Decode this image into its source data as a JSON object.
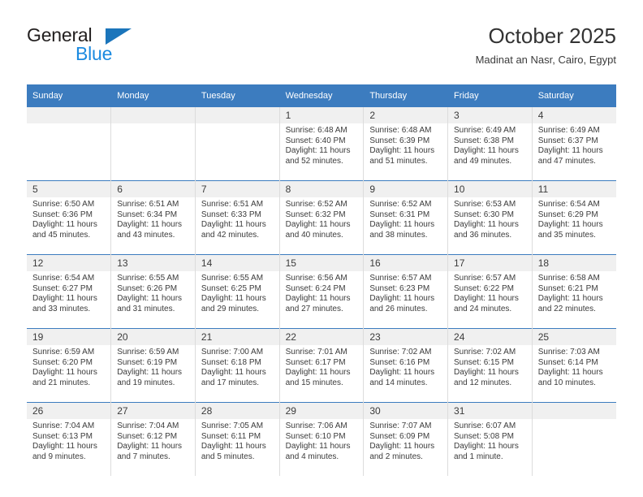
{
  "brand": {
    "general": "General",
    "blue": "Blue",
    "accent_color": "#1b75bb",
    "blue_text_color": "#1b8ae0"
  },
  "header": {
    "title": "October 2025",
    "subtitle": "Madinat an Nasr, Cairo, Egypt"
  },
  "theme": {
    "header_blue": "#3c7cbf",
    "daynum_band": "#f0f0f0",
    "text": "#3b3b3b",
    "divider": "#dcdcdc"
  },
  "calendar": {
    "day_headers": [
      "Sunday",
      "Monday",
      "Tuesday",
      "Wednesday",
      "Thursday",
      "Friday",
      "Saturday"
    ],
    "weeks": [
      [
        {
          "day": "",
          "sunrise": "",
          "sunset": "",
          "daylight1": "",
          "daylight2": ""
        },
        {
          "day": "",
          "sunrise": "",
          "sunset": "",
          "daylight1": "",
          "daylight2": ""
        },
        {
          "day": "",
          "sunrise": "",
          "sunset": "",
          "daylight1": "",
          "daylight2": ""
        },
        {
          "day": "1",
          "sunrise": "Sunrise: 6:48 AM",
          "sunset": "Sunset: 6:40 PM",
          "daylight1": "Daylight: 11 hours",
          "daylight2": "and 52 minutes."
        },
        {
          "day": "2",
          "sunrise": "Sunrise: 6:48 AM",
          "sunset": "Sunset: 6:39 PM",
          "daylight1": "Daylight: 11 hours",
          "daylight2": "and 51 minutes."
        },
        {
          "day": "3",
          "sunrise": "Sunrise: 6:49 AM",
          "sunset": "Sunset: 6:38 PM",
          "daylight1": "Daylight: 11 hours",
          "daylight2": "and 49 minutes."
        },
        {
          "day": "4",
          "sunrise": "Sunrise: 6:49 AM",
          "sunset": "Sunset: 6:37 PM",
          "daylight1": "Daylight: 11 hours",
          "daylight2": "and 47 minutes."
        }
      ],
      [
        {
          "day": "5",
          "sunrise": "Sunrise: 6:50 AM",
          "sunset": "Sunset: 6:36 PM",
          "daylight1": "Daylight: 11 hours",
          "daylight2": "and 45 minutes."
        },
        {
          "day": "6",
          "sunrise": "Sunrise: 6:51 AM",
          "sunset": "Sunset: 6:34 PM",
          "daylight1": "Daylight: 11 hours",
          "daylight2": "and 43 minutes."
        },
        {
          "day": "7",
          "sunrise": "Sunrise: 6:51 AM",
          "sunset": "Sunset: 6:33 PM",
          "daylight1": "Daylight: 11 hours",
          "daylight2": "and 42 minutes."
        },
        {
          "day": "8",
          "sunrise": "Sunrise: 6:52 AM",
          "sunset": "Sunset: 6:32 PM",
          "daylight1": "Daylight: 11 hours",
          "daylight2": "and 40 minutes."
        },
        {
          "day": "9",
          "sunrise": "Sunrise: 6:52 AM",
          "sunset": "Sunset: 6:31 PM",
          "daylight1": "Daylight: 11 hours",
          "daylight2": "and 38 minutes."
        },
        {
          "day": "10",
          "sunrise": "Sunrise: 6:53 AM",
          "sunset": "Sunset: 6:30 PM",
          "daylight1": "Daylight: 11 hours",
          "daylight2": "and 36 minutes."
        },
        {
          "day": "11",
          "sunrise": "Sunrise: 6:54 AM",
          "sunset": "Sunset: 6:29 PM",
          "daylight1": "Daylight: 11 hours",
          "daylight2": "and 35 minutes."
        }
      ],
      [
        {
          "day": "12",
          "sunrise": "Sunrise: 6:54 AM",
          "sunset": "Sunset: 6:27 PM",
          "daylight1": "Daylight: 11 hours",
          "daylight2": "and 33 minutes."
        },
        {
          "day": "13",
          "sunrise": "Sunrise: 6:55 AM",
          "sunset": "Sunset: 6:26 PM",
          "daylight1": "Daylight: 11 hours",
          "daylight2": "and 31 minutes."
        },
        {
          "day": "14",
          "sunrise": "Sunrise: 6:55 AM",
          "sunset": "Sunset: 6:25 PM",
          "daylight1": "Daylight: 11 hours",
          "daylight2": "and 29 minutes."
        },
        {
          "day": "15",
          "sunrise": "Sunrise: 6:56 AM",
          "sunset": "Sunset: 6:24 PM",
          "daylight1": "Daylight: 11 hours",
          "daylight2": "and 27 minutes."
        },
        {
          "day": "16",
          "sunrise": "Sunrise: 6:57 AM",
          "sunset": "Sunset: 6:23 PM",
          "daylight1": "Daylight: 11 hours",
          "daylight2": "and 26 minutes."
        },
        {
          "day": "17",
          "sunrise": "Sunrise: 6:57 AM",
          "sunset": "Sunset: 6:22 PM",
          "daylight1": "Daylight: 11 hours",
          "daylight2": "and 24 minutes."
        },
        {
          "day": "18",
          "sunrise": "Sunrise: 6:58 AM",
          "sunset": "Sunset: 6:21 PM",
          "daylight1": "Daylight: 11 hours",
          "daylight2": "and 22 minutes."
        }
      ],
      [
        {
          "day": "19",
          "sunrise": "Sunrise: 6:59 AM",
          "sunset": "Sunset: 6:20 PM",
          "daylight1": "Daylight: 11 hours",
          "daylight2": "and 21 minutes."
        },
        {
          "day": "20",
          "sunrise": "Sunrise: 6:59 AM",
          "sunset": "Sunset: 6:19 PM",
          "daylight1": "Daylight: 11 hours",
          "daylight2": "and 19 minutes."
        },
        {
          "day": "21",
          "sunrise": "Sunrise: 7:00 AM",
          "sunset": "Sunset: 6:18 PM",
          "daylight1": "Daylight: 11 hours",
          "daylight2": "and 17 minutes."
        },
        {
          "day": "22",
          "sunrise": "Sunrise: 7:01 AM",
          "sunset": "Sunset: 6:17 PM",
          "daylight1": "Daylight: 11 hours",
          "daylight2": "and 15 minutes."
        },
        {
          "day": "23",
          "sunrise": "Sunrise: 7:02 AM",
          "sunset": "Sunset: 6:16 PM",
          "daylight1": "Daylight: 11 hours",
          "daylight2": "and 14 minutes."
        },
        {
          "day": "24",
          "sunrise": "Sunrise: 7:02 AM",
          "sunset": "Sunset: 6:15 PM",
          "daylight1": "Daylight: 11 hours",
          "daylight2": "and 12 minutes."
        },
        {
          "day": "25",
          "sunrise": "Sunrise: 7:03 AM",
          "sunset": "Sunset: 6:14 PM",
          "daylight1": "Daylight: 11 hours",
          "daylight2": "and 10 minutes."
        }
      ],
      [
        {
          "day": "26",
          "sunrise": "Sunrise: 7:04 AM",
          "sunset": "Sunset: 6:13 PM",
          "daylight1": "Daylight: 11 hours",
          "daylight2": "and 9 minutes."
        },
        {
          "day": "27",
          "sunrise": "Sunrise: 7:04 AM",
          "sunset": "Sunset: 6:12 PM",
          "daylight1": "Daylight: 11 hours",
          "daylight2": "and 7 minutes."
        },
        {
          "day": "28",
          "sunrise": "Sunrise: 7:05 AM",
          "sunset": "Sunset: 6:11 PM",
          "daylight1": "Daylight: 11 hours",
          "daylight2": "and 5 minutes."
        },
        {
          "day": "29",
          "sunrise": "Sunrise: 7:06 AM",
          "sunset": "Sunset: 6:10 PM",
          "daylight1": "Daylight: 11 hours",
          "daylight2": "and 4 minutes."
        },
        {
          "day": "30",
          "sunrise": "Sunrise: 7:07 AM",
          "sunset": "Sunset: 6:09 PM",
          "daylight1": "Daylight: 11 hours",
          "daylight2": "and 2 minutes."
        },
        {
          "day": "31",
          "sunrise": "Sunrise: 6:07 AM",
          "sunset": "Sunset: 5:08 PM",
          "daylight1": "Daylight: 11 hours",
          "daylight2": "and 1 minute."
        },
        {
          "day": "",
          "sunrise": "",
          "sunset": "",
          "daylight1": "",
          "daylight2": ""
        }
      ]
    ]
  }
}
